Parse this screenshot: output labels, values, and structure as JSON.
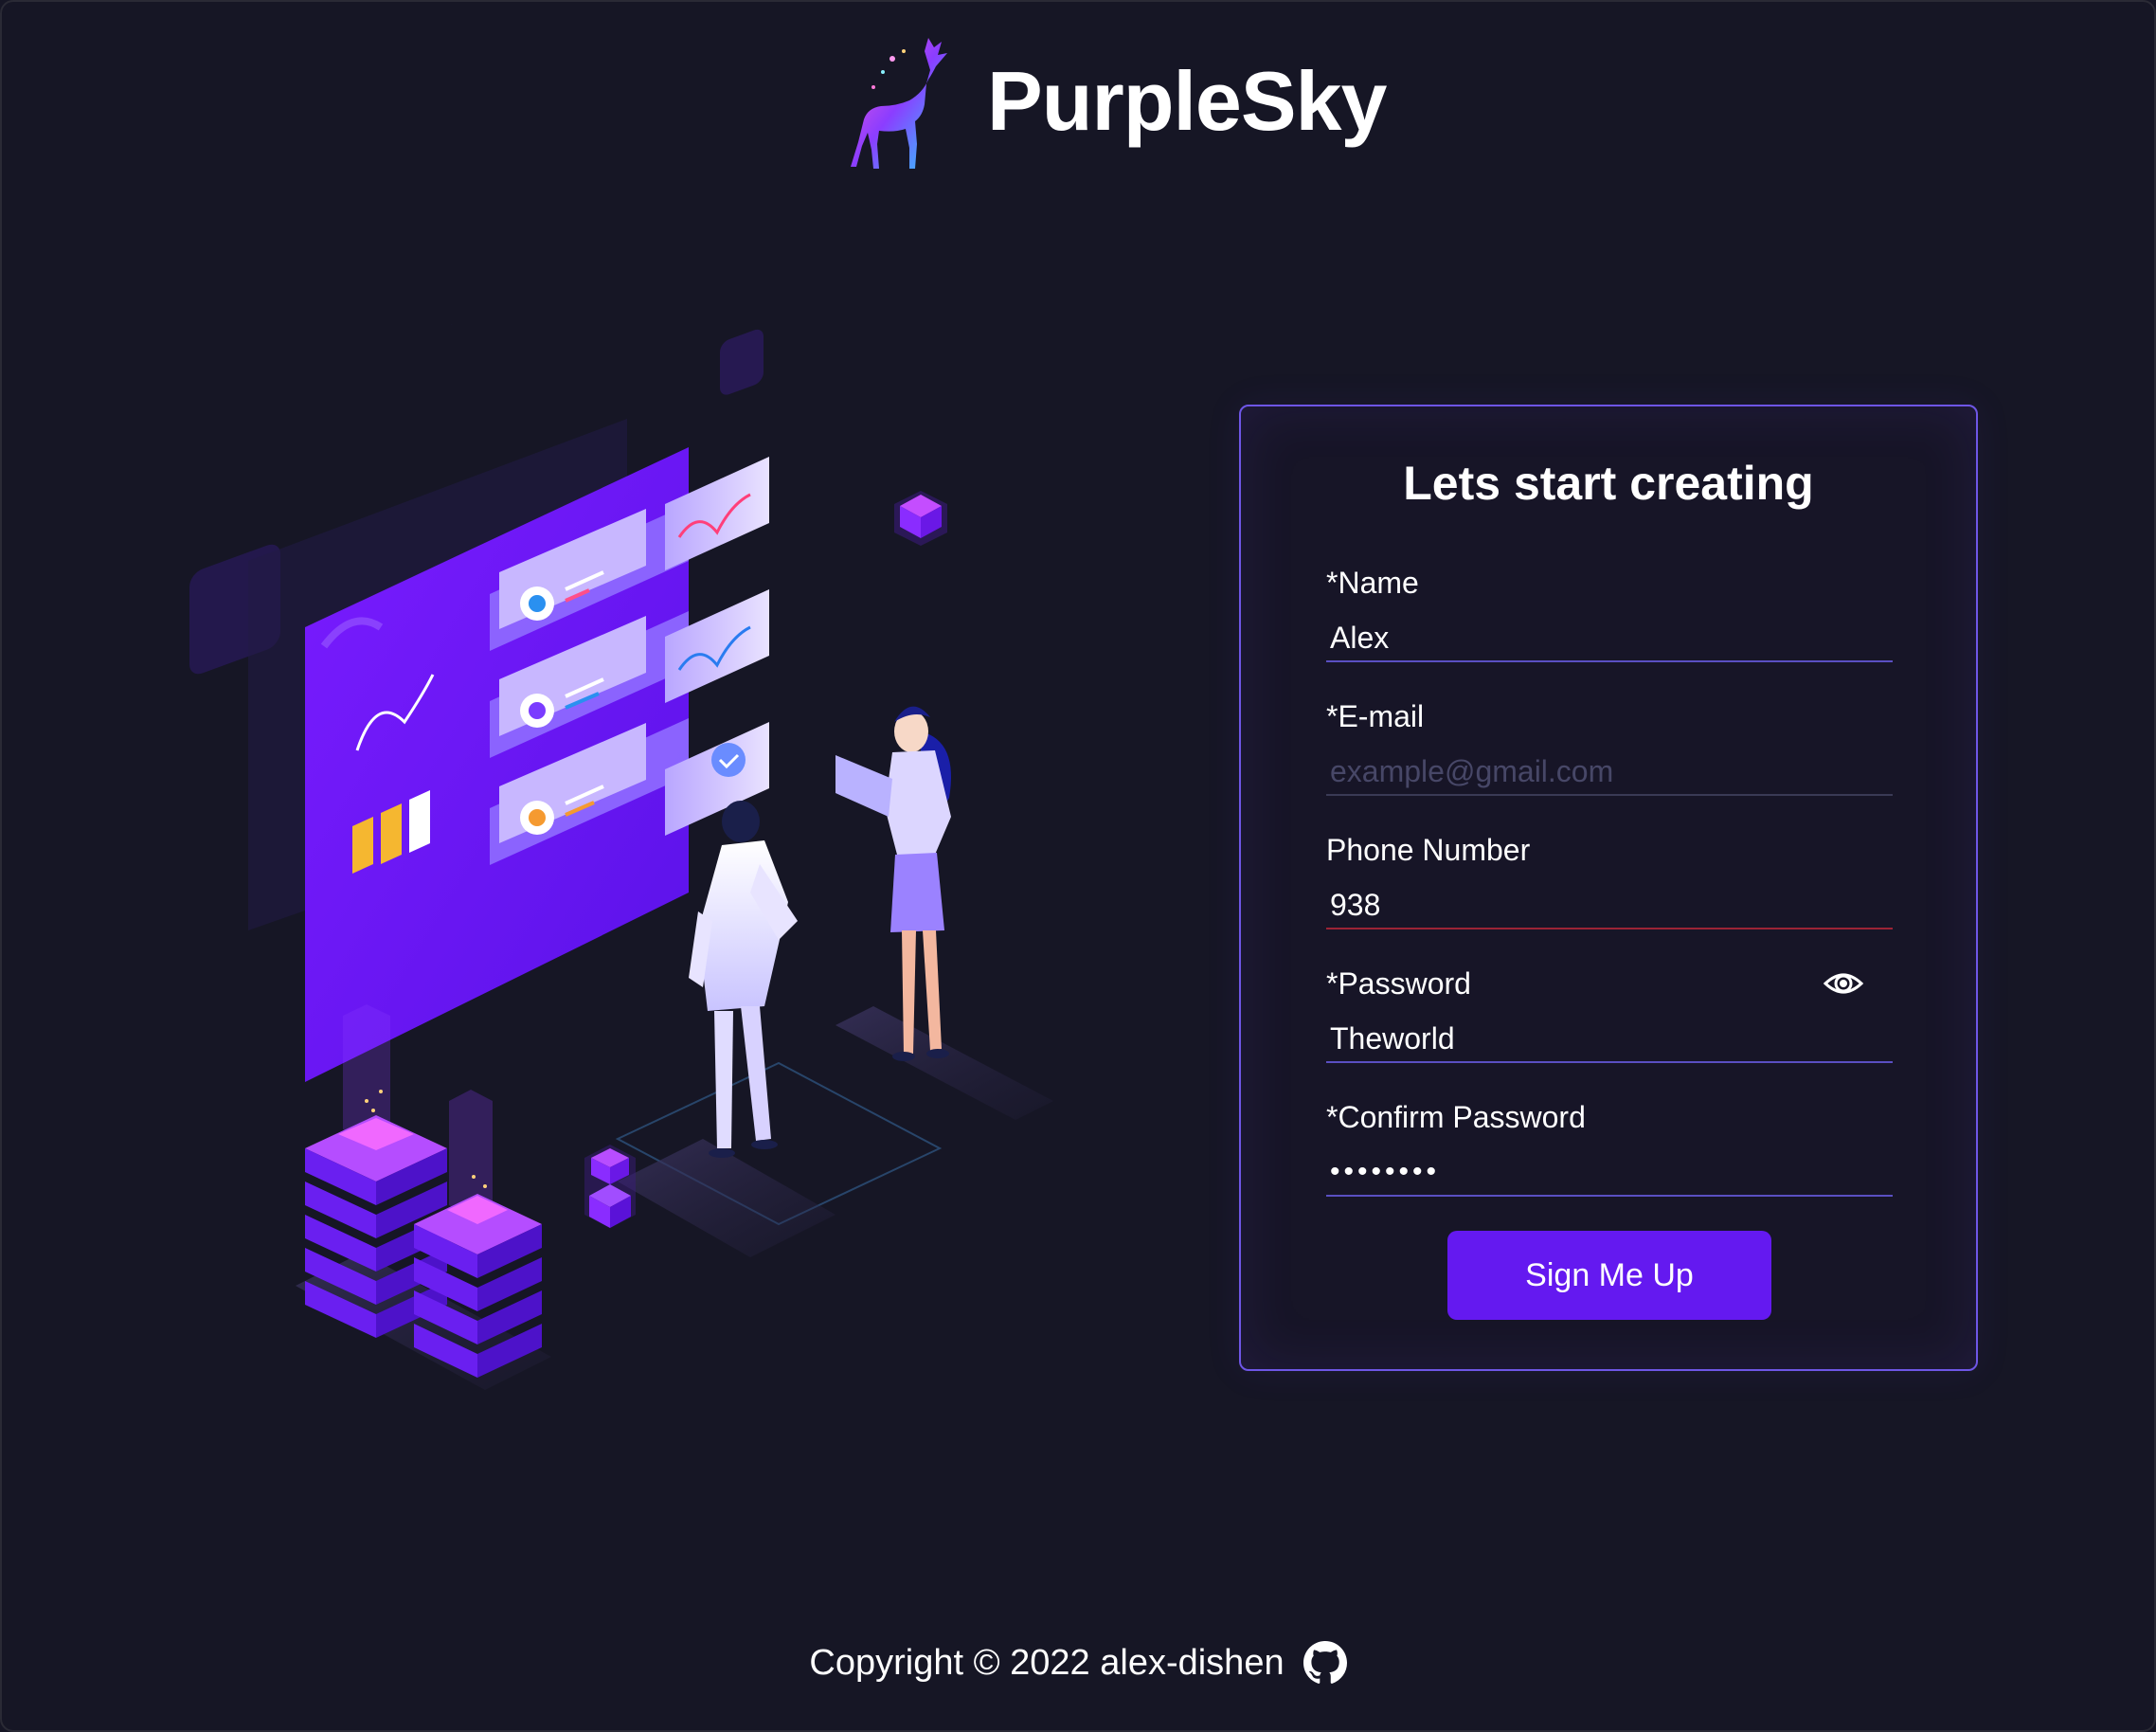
{
  "header": {
    "brand": "PurpleSky",
    "logo_icon": "deer-logo-icon"
  },
  "illustration": {
    "icon": "isometric-team-dashboard-illustration"
  },
  "form": {
    "title": "Lets start creating",
    "fields": {
      "name": {
        "label": "*Name",
        "value": "Alex",
        "placeholder": ""
      },
      "email": {
        "label": "*E-mail",
        "value": "",
        "placeholder": "example@gmail.com"
      },
      "phone": {
        "label": "Phone Number",
        "value": "938",
        "placeholder": ""
      },
      "password": {
        "label": "*Password",
        "value": "Theworld",
        "placeholder": "",
        "toggle_icon": "eye-icon"
      },
      "confirm_password": {
        "label": "*Confirm Password",
        "value": "••••••••",
        "placeholder": ""
      }
    },
    "submit_label": "Sign Me Up"
  },
  "footer": {
    "copyright": "Copyright © 2022 alex-dishen",
    "link_icon": "github-icon"
  },
  "colors": {
    "background": "#161625",
    "accent": "#6419f0",
    "card_border": "#6e56e6",
    "input_underline": "#5a4fc2",
    "error_underline": "#9b2335",
    "placeholder": "#474767"
  }
}
